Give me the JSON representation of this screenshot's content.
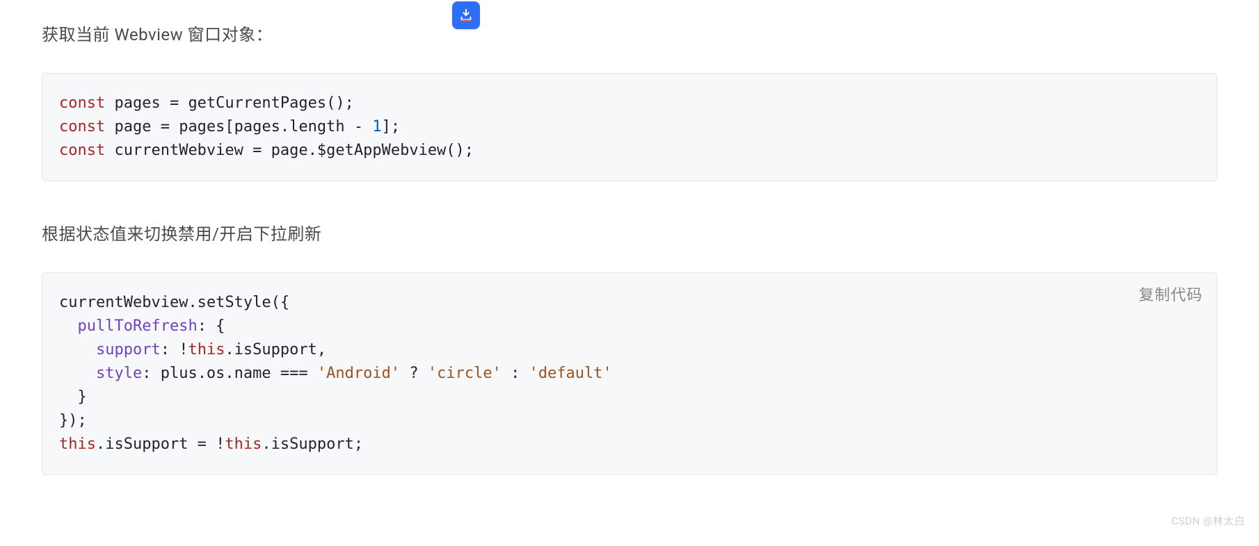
{
  "floatingIcon": {
    "name": "download-book-icon"
  },
  "sections": [
    {
      "heading": "获取当前 Webview 窗口对象：",
      "code_html": "<span class=\"kw\">const</span> pages = getCurrentPages();\n<span class=\"kw\">const</span> page = pages[pages.length - <span class=\"num\">1</span>];\n<span class=\"kw\">const</span> currentWebview = page.$getAppWebview();",
      "copy_label": null
    },
    {
      "heading": "根据状态值来切换禁用/开启下拉刷新",
      "code_html": "currentWebview.setStyle({\n  <span class=\"attr\">pullToRefresh</span>: {\n    <span class=\"attr\">support</span>: !<span class=\"kw\">this</span>.isSupport,\n    <span class=\"attr\">style</span>: plus.os.name === <span class=\"str\">'Android'</span> ? <span class=\"str\">'circle'</span> : <span class=\"str\">'default'</span>\n  }\n});\n<span class=\"kw\">this</span>.isSupport = !<span class=\"kw\">this</span>.isSupport;",
      "copy_label": "复制代码"
    }
  ],
  "watermark": "CSDN @林太白"
}
